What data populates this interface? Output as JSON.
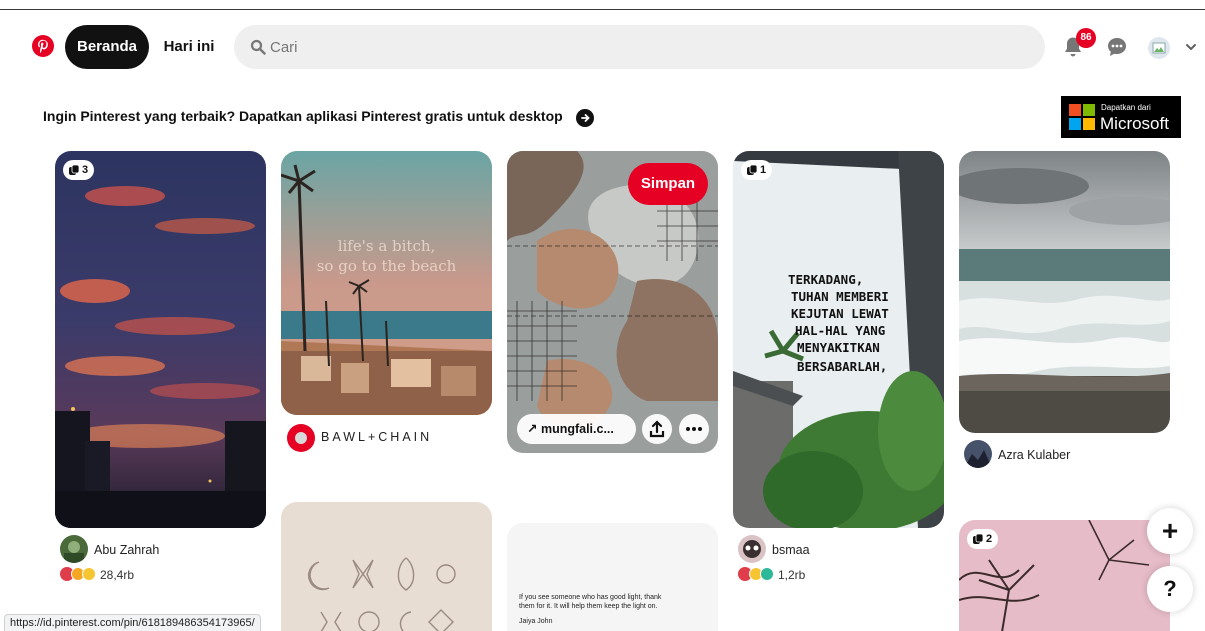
{
  "header": {
    "logo_label": "Pinterest",
    "home_label": "Beranda",
    "today_label": "Hari ini",
    "search_placeholder": "Cari",
    "notification_count": "86"
  },
  "promo": {
    "text": "Ingin Pinterest yang terbaik? Dapatkan aplikasi Pinterest gratis untuk desktop",
    "ms_small": "Dapatkan dari",
    "ms_big": "Microsoft"
  },
  "pins": [
    {
      "id": "sunset",
      "count": "3",
      "author": "Abu Zahrah",
      "reactions": "28,4rb"
    },
    {
      "id": "beach",
      "overlay_text_1": "life's a bitch,",
      "overlay_text_2": "so go to the beach",
      "author": "BAWL+CHAIN"
    },
    {
      "id": "abstract",
      "save_label": "Simpan",
      "link_label": "mungfali.c..."
    },
    {
      "id": "quote",
      "count": "1",
      "quote_lines": [
        "TERKADANG,",
        "TUHAN MEMBERI",
        "KEJUTAN LEWAT",
        "HAL-HAL YANG",
        "MENYAKITKAN",
        "BERSABARLAH,"
      ],
      "author": "bsmaa",
      "reactions": "1,2rb"
    },
    {
      "id": "sea",
      "author": "Azra Kulaber"
    },
    {
      "id": "tree",
      "count": "2"
    },
    {
      "id": "symbols"
    },
    {
      "id": "textcard",
      "text_1": "If you see someone who has good light, thank",
      "text_2": "them for it. It will help them keep the light on.",
      "sub": "Jaiya John"
    }
  ],
  "floating": {
    "plus": "+",
    "help": "?"
  },
  "statusbar": {
    "url": "https://id.pinterest.com/pin/618189486354173965/"
  },
  "colors": {
    "brand_red": "#e60023",
    "dark": "#111111",
    "search_bg": "#efefef"
  }
}
